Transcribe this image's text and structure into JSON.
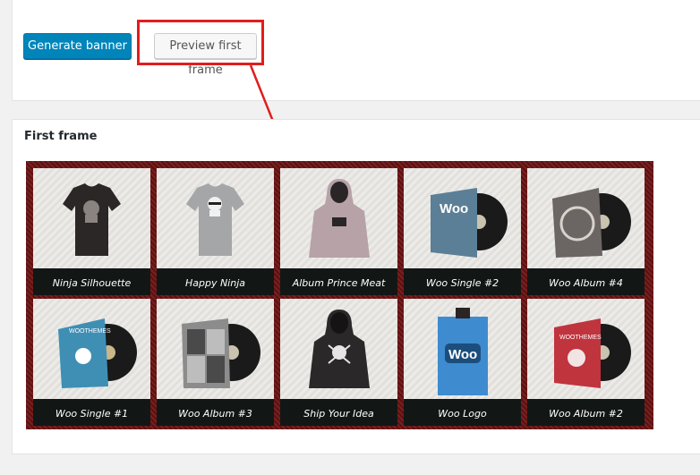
{
  "toolbar": {
    "generate_label": "Generate banner",
    "preview_label": "Preview first frame"
  },
  "first_frame": {
    "title": "First frame",
    "products": [
      {
        "name": "Ninja Silhouette"
      },
      {
        "name": "Happy Ninja"
      },
      {
        "name": "Album Prince Meat"
      },
      {
        "name": "Woo Single #2"
      },
      {
        "name": "Woo Album #4"
      },
      {
        "name": "Woo Single #1"
      },
      {
        "name": "Woo Album #3"
      },
      {
        "name": "Ship Your Idea"
      },
      {
        "name": "Woo Logo"
      },
      {
        "name": "Woo Album #2"
      }
    ]
  },
  "images": {
    "woo_text": "Woo",
    "woothemes_text": "WOOTHEMES"
  },
  "colors": {
    "primary_button": "#0085ba",
    "highlight": "#e11d1d",
    "banner_border": "#6a1818",
    "caption_bar": "#121716"
  }
}
